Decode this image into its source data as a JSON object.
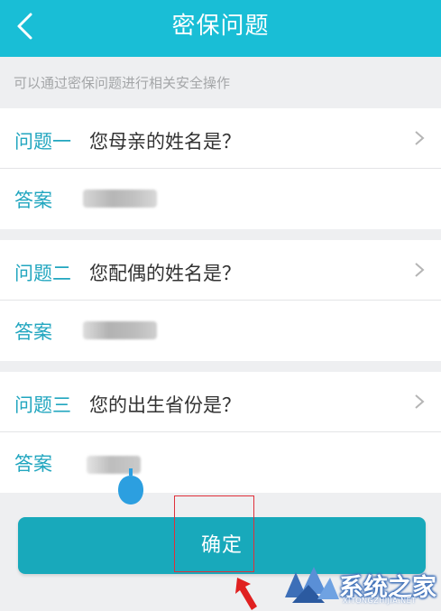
{
  "header": {
    "title": "密保问题",
    "background": "#19bed6"
  },
  "hint": "可以通过密保问题进行相关安全操作",
  "questions": [
    {
      "label": "问题一",
      "text": "您母亲的姓名是？",
      "answer_label": "答案"
    },
    {
      "label": "问题二",
      "text": "您配偶的姓名是？",
      "answer_label": "答案"
    },
    {
      "label": "问题三",
      "text": "您的出生省份是？",
      "answer_label": "答案"
    }
  ],
  "confirm_label": "确定",
  "colors": {
    "accent": "#21a6bf",
    "button": "#18a9bb",
    "highlight": "#e0303a",
    "cursor": "#2c9fe0"
  },
  "watermark": {
    "text": "系统之家",
    "sub": "XITONGZHIJIA.NET"
  }
}
